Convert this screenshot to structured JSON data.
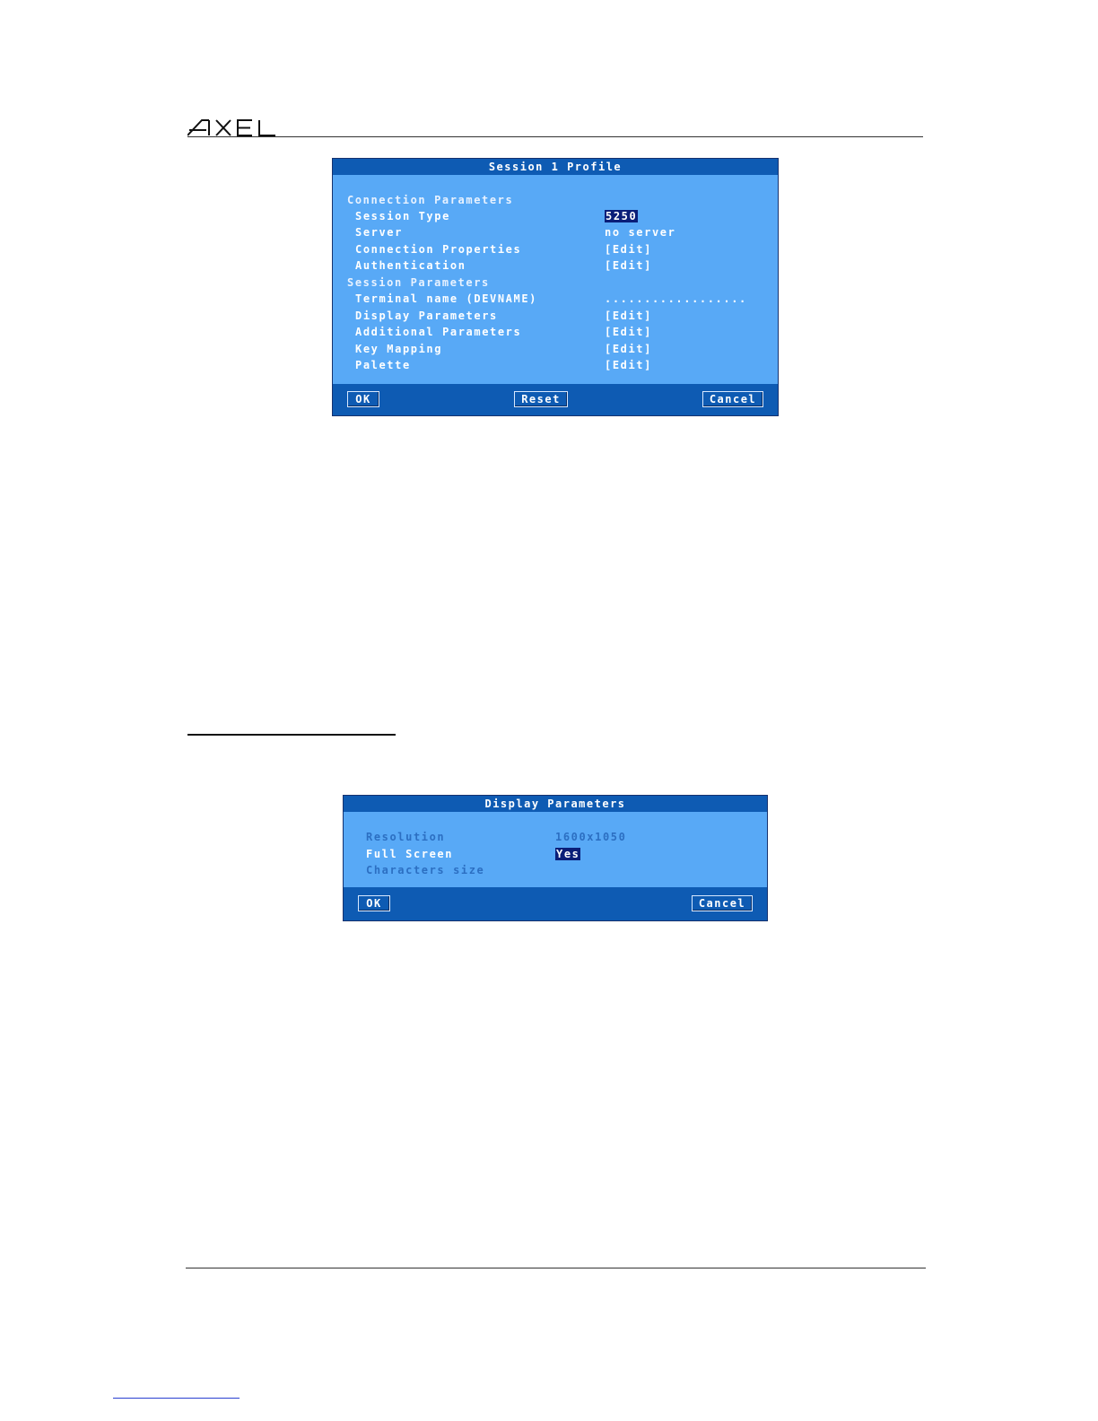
{
  "brand": {
    "logo_text": "AXEL"
  },
  "session_profile": {
    "title": "Session 1 Profile",
    "connection_section": "Connection Parameters",
    "session_type_label": "Session Type",
    "session_type_value": "5250",
    "server_label": "Server",
    "server_value": "no server",
    "connection_properties_label": "Connection Properties",
    "connection_properties_value": "[Edit]",
    "authentication_label": "Authentication",
    "authentication_value": "[Edit]",
    "session_section": "Session Parameters",
    "terminal_name_label": "Terminal name (DEVNAME)",
    "terminal_name_value": "..................",
    "display_parameters_label": "Display Parameters",
    "display_parameters_value": "[Edit]",
    "additional_parameters_label": "Additional Parameters",
    "additional_parameters_value": "[Edit]",
    "key_mapping_label": "Key Mapping",
    "key_mapping_value": "[Edit]",
    "palette_label": "Palette",
    "palette_value": "[Edit]",
    "ok_label": "OK",
    "reset_label": "Reset",
    "cancel_label": "Cancel"
  },
  "display_parameters": {
    "title": "Display Parameters",
    "resolution_label": "Resolution",
    "resolution_value": "1600x1050",
    "full_screen_label": "Full Screen",
    "full_screen_value": "Yes",
    "characters_size_label": "Characters size",
    "ok_label": "OK",
    "cancel_label": "Cancel"
  },
  "colors": {
    "dialog_body": "#58a9f6",
    "dialog_bar": "#0e5bb3",
    "selection": "#0a1e78",
    "disabled_text": "#2c6fc2"
  }
}
